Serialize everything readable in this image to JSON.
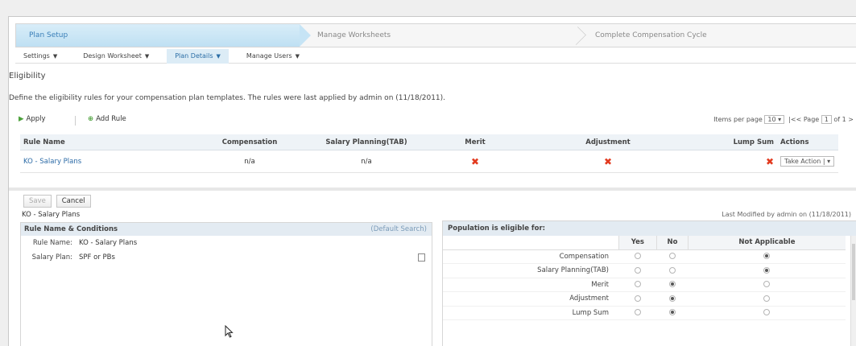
{
  "wizard": {
    "step1": "Plan Setup",
    "step2": "Manage Worksheets",
    "step3": "Complete Compensation Cycle"
  },
  "menus": [
    {
      "label": "Settings"
    },
    {
      "label": "Design Worksheet"
    },
    {
      "label": "Plan Details"
    },
    {
      "label": "Manage Users"
    }
  ],
  "section_title": "Eligibility",
  "description": "Define the eligibility rules for your compensation plan templates. The rules were last applied by admin on (11/18/2011).",
  "toolbar": {
    "apply": "Apply",
    "add_rule": "Add Rule",
    "items_per_page_label": "Items per page",
    "items_per_page": "10",
    "page_label": "Page",
    "page_value": "1",
    "page_of": "of 1"
  },
  "grid": {
    "headers": [
      "Rule Name",
      "Compensation",
      "Salary Planning(TAB)",
      "Merit",
      "Adjustment",
      "Lump Sum",
      "Actions"
    ],
    "row": {
      "name": "KO - Salary Plans",
      "compensation": "n/a",
      "salary_planning": "n/a",
      "action": "Take Action"
    }
  },
  "buttons": {
    "save": "Save",
    "cancel": "Cancel"
  },
  "rule_title": "KO - Salary Plans",
  "last_modified": "Last Modified by admin on (11/18/2011)",
  "left_panel": {
    "title": "Rule Name & Conditions",
    "right_label": "(Default Search)",
    "rule_name_key": "Rule Name:",
    "rule_name_val": "KO - Salary Plans",
    "salary_plan_key": "Salary Plan:",
    "salary_plan_val": "SPF or PBs"
  },
  "right_panel": {
    "title": "Population is eligible for:",
    "columns": [
      "Yes",
      "No",
      "Not Applicable"
    ],
    "rows": [
      {
        "label": "Compensation",
        "selected": 2
      },
      {
        "label": "Salary Planning(TAB)",
        "selected": 2
      },
      {
        "label": "Merit",
        "selected": 1
      },
      {
        "label": "Adjustment",
        "selected": 1
      },
      {
        "label": "Lump Sum",
        "selected": 1
      }
    ]
  }
}
